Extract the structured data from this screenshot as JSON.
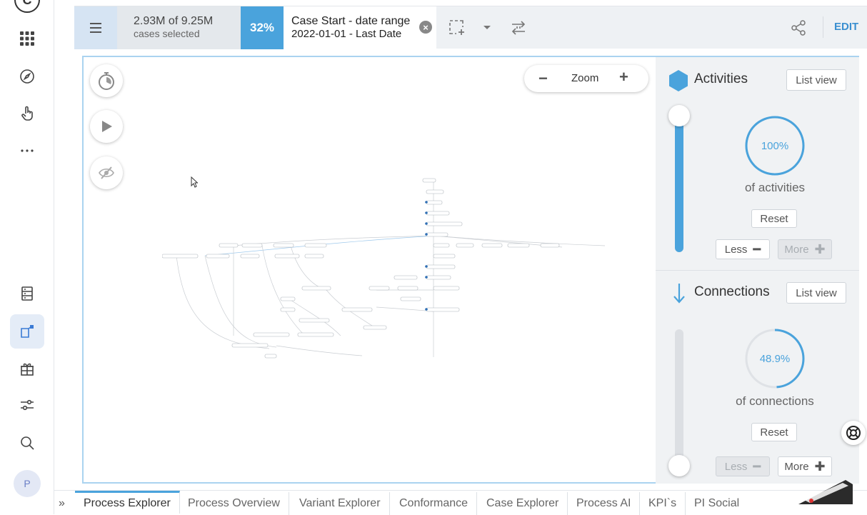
{
  "nav": {
    "logo": "C",
    "avatar": "P",
    "items": [
      "apps-grid",
      "compass",
      "pointer",
      "more",
      "database",
      "process-explorer",
      "gift",
      "sliders",
      "search"
    ]
  },
  "topbar": {
    "cases_line1": "2.93M of 9.25M",
    "cases_line2": "cases selected",
    "percent": "32%",
    "filter_title": "Case Start - date range",
    "filter_value": "2022-01-01 - Last Date",
    "edit": "EDIT"
  },
  "canvas": {
    "zoom_label": "Zoom",
    "zoom_minus": "−",
    "zoom_plus": "+"
  },
  "activities": {
    "title": "Activities",
    "list_view": "List view",
    "percent": "100%",
    "percent_value": 1.0,
    "of_label": "of activities",
    "reset": "Reset",
    "less": "Less",
    "more": "More",
    "slider_level": 1.0
  },
  "connections": {
    "title": "Connections",
    "list_view": "List view",
    "percent": "48.9%",
    "percent_value": 0.489,
    "of_label": "of connections",
    "reset": "Reset",
    "less": "Less",
    "more": "More",
    "slider_level": 0.0
  },
  "tabs": [
    "Process Explorer",
    "Process Overview",
    "Variant Explorer",
    "Conformance",
    "Case Explorer",
    "Process AI",
    "KPI`s",
    "PI Social"
  ],
  "colors": {
    "accent": "#4aa3dc",
    "panel": "#f0f2f4"
  }
}
